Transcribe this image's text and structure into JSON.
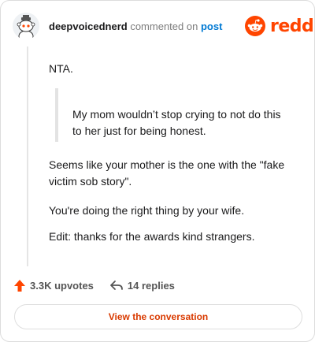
{
  "comment": {
    "username": "deepvoicednerd",
    "action_text": "commented on",
    "post_link": "post",
    "paragraphs": {
      "nta": "NTA.",
      "quote": "My mom wouldn’t stop crying to not do this to her just for being honest.",
      "p1": "Seems like your mother is the one with the \"fake victim sob story\".",
      "p2": "You're doing the right thing by your wife.",
      "p3": "Edit: thanks for the awards kind strangers."
    }
  },
  "brand": {
    "logo_text": "reddit",
    "accent_color": "#ff4500"
  },
  "actions": {
    "upvotes": "3.3K upvotes",
    "replies": "14 replies"
  },
  "cta": {
    "label": "View the conversation"
  },
  "icons": {
    "avatar": "snoo-avatar-icon",
    "logo": "reddit-alien-icon",
    "upvote": "upvote-arrow-icon",
    "reply": "reply-arrow-icon"
  }
}
